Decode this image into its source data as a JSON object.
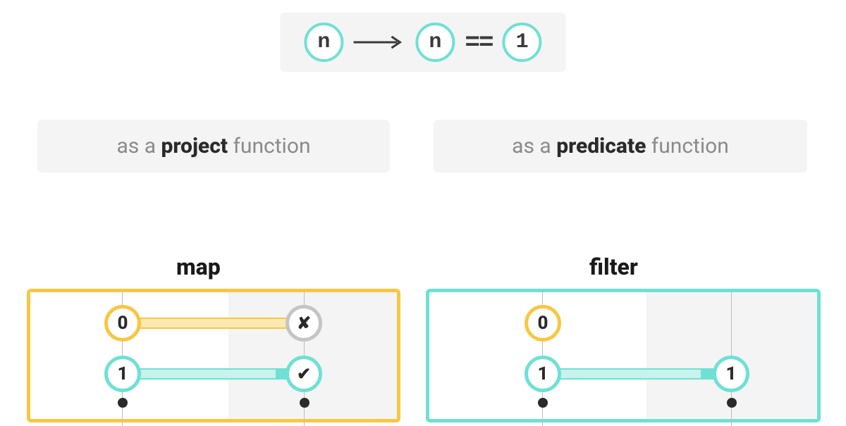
{
  "expression": {
    "lhs": "n",
    "rhs_var": "n",
    "operator": "==",
    "rhs_val": "1"
  },
  "labels": {
    "left_prefix": "as a ",
    "left_bold": "project",
    "left_suffix": " function",
    "right_prefix": "as a ",
    "right_bold": "predicate",
    "right_suffix": " function"
  },
  "sections": {
    "map_title": "map",
    "filter_title": "filter"
  },
  "map_diagram": {
    "input_row1": "0",
    "output_row1_symbol": "✘",
    "input_row2": "1",
    "output_row2_symbol": "✔"
  },
  "filter_diagram": {
    "input_row1": "0",
    "input_row2": "1",
    "output_row2": "1"
  },
  "colors": {
    "teal": "#6fe0d4",
    "yellow": "#f7c744",
    "gray": "#c4c4c4"
  }
}
